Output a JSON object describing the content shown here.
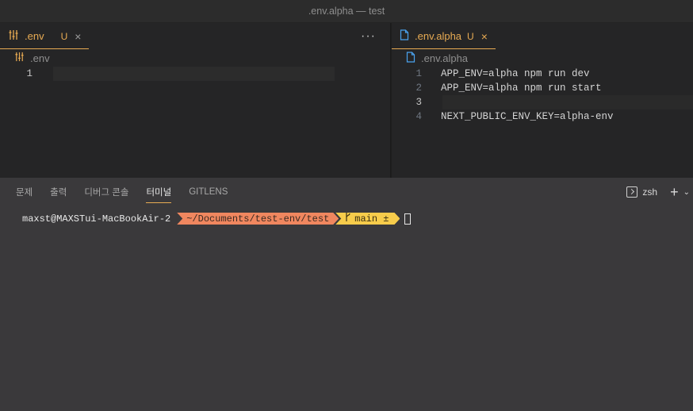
{
  "window": {
    "title": ".env.alpha — test"
  },
  "left_editor": {
    "tab": {
      "label": ".env",
      "status": "U",
      "close": "×"
    },
    "more": "···",
    "breadcrumb": ".env",
    "lines": [
      {
        "num": "1",
        "text": ""
      }
    ]
  },
  "right_editor": {
    "tab": {
      "label": ".env.alpha",
      "status": "U",
      "close": "×"
    },
    "breadcrumb": ".env.alpha",
    "lines": [
      {
        "num": "1",
        "text": "APP_ENV=alpha npm run dev"
      },
      {
        "num": "2",
        "text": "APP_ENV=alpha npm run start"
      },
      {
        "num": "3",
        "text": ""
      },
      {
        "num": "4",
        "text": "NEXT_PUBLIC_ENV_KEY=alpha-env"
      }
    ]
  },
  "panel": {
    "tabs": [
      "문제",
      "출력",
      "디버그 콘솔",
      "터미널",
      "GITLENS"
    ],
    "active_tab": "터미널",
    "shell": "zsh",
    "add": "+",
    "chevron": "⌄"
  },
  "terminal": {
    "user": "maxst@MAXSTui-MacBookAir-2",
    "path": "~/Documents/test-env/test",
    "git": "main ±"
  },
  "colors": {
    "accent": "#e8ab53",
    "path_segment": "#f0875f",
    "git_segment": "#f7cc4b",
    "panel_bg": "#3a393b"
  },
  "icons": {
    "env_file": "settings-sliders-icon",
    "alpha_file": "file-icon",
    "terminal": "terminal-icon"
  }
}
